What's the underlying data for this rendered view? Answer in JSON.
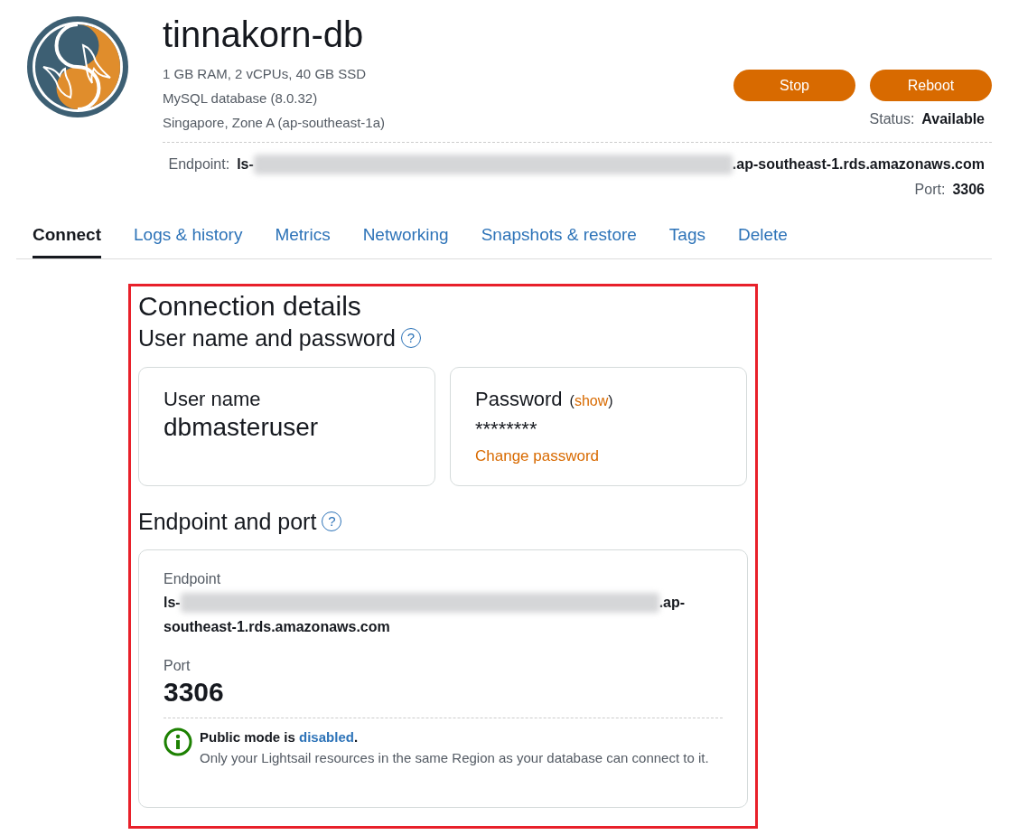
{
  "header": {
    "title": "tinnakorn-db",
    "specs": [
      "1 GB RAM, 2 vCPUs, 40 GB SSD",
      "MySQL database (8.0.32)",
      "Singapore, Zone A (ap-southeast-1a)"
    ],
    "buttons": [
      "Stop",
      "Reboot"
    ],
    "status": {
      "label": "Status:",
      "value": "Available"
    },
    "endpoint": {
      "label": "Endpoint:",
      "prefix": "ls-",
      "suffix": ".ap-southeast-1.rds.amazonaws.com"
    },
    "port": {
      "label": "Port:",
      "value": "3306"
    }
  },
  "tabs": [
    {
      "label": "Connect",
      "selected": true
    },
    {
      "label": "Logs & history",
      "selected": false
    },
    {
      "label": "Metrics",
      "selected": false
    },
    {
      "label": "Networking",
      "selected": false
    },
    {
      "label": "Snapshots & restore",
      "selected": false
    },
    {
      "label": "Tags",
      "selected": false
    },
    {
      "label": "Delete",
      "selected": false
    }
  ],
  "connection": {
    "title": "Connection details",
    "credentials": {
      "heading": "User name and password",
      "help": "?",
      "user": {
        "label": "User name",
        "value": "dbmasteruser"
      },
      "password": {
        "label": "Password",
        "show_before": "(",
        "show_link": "show",
        "show_after": ")",
        "masked": "********",
        "change_link": "Change password"
      }
    },
    "endpoint_section": {
      "heading": "Endpoint and port",
      "help": "?",
      "endpoint_label": "Endpoint",
      "endpoint_prefix": "ls-",
      "endpoint_suffix": ".ap-southeast-1.rds.amazonaws.com",
      "port_label": "Port",
      "port_value": "3306",
      "notice": {
        "before": "Public mode is ",
        "link": "disabled",
        "after": ".",
        "text": "Only your Lightsail resources in the same Region as your database can connect to it."
      }
    }
  }
}
